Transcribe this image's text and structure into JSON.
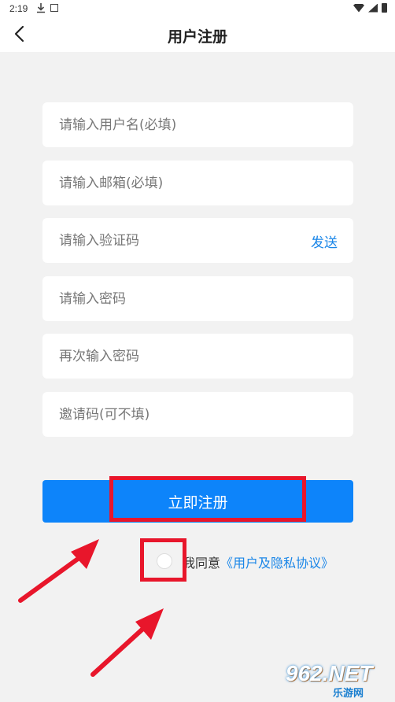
{
  "status_bar": {
    "time": "2:19"
  },
  "header": {
    "title": "用户注册"
  },
  "form": {
    "username_placeholder": "请输入用户名(必填)",
    "email_placeholder": "请输入邮箱(必填)",
    "code_placeholder": "请输入验证码",
    "send_label": "发送",
    "password_placeholder": "请输入密码",
    "confirm_placeholder": "再次输入密码",
    "invite_placeholder": "邀请码(可不填)"
  },
  "register_button": "立即注册",
  "agreement": {
    "prefix": "我同意",
    "link": "《用户及隐私协议》",
    "checked": false
  },
  "watermark": {
    "logo": "962.NET",
    "sub": "乐游网"
  },
  "colors": {
    "accent": "#0d84fa",
    "link": "#1a86e8",
    "highlight": "#e8162b"
  }
}
